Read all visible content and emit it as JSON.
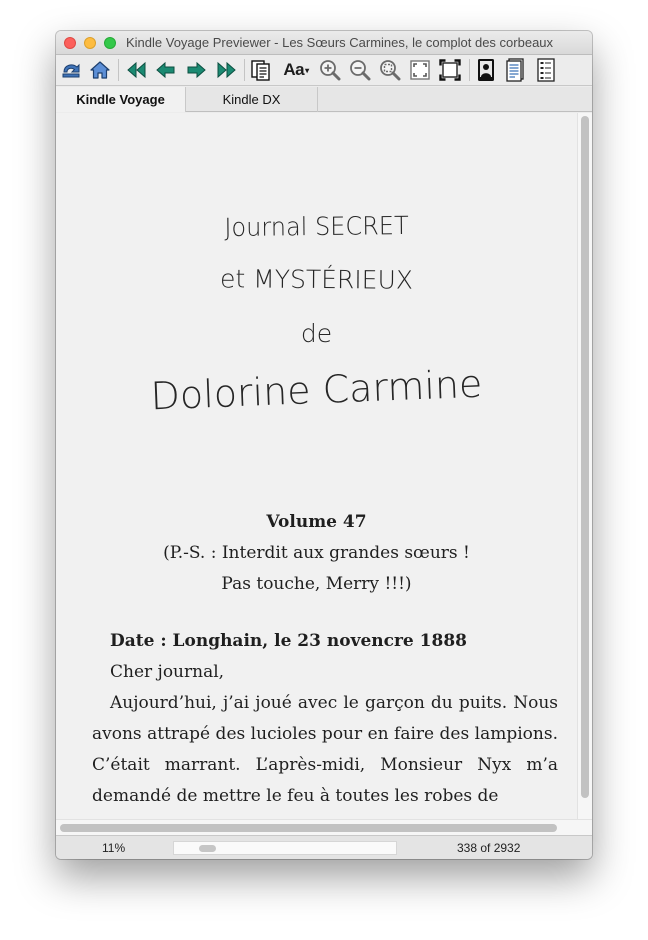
{
  "window": {
    "title": "Kindle Voyage Previewer - Les Sœurs Carmines, le complot des corbeaux"
  },
  "toolbar": {
    "font_button_label": "Aa",
    "font_button_caret": "▾"
  },
  "tabs": [
    {
      "label": "Kindle Voyage",
      "active": true
    },
    {
      "label": "Kindle DX",
      "active": false
    }
  ],
  "book": {
    "heading_lines": [
      "Journal SECRET",
      "et MYSTÉRIEUX",
      "de",
      "Dolorine Carmine"
    ],
    "volume": "Volume 47",
    "ps_line1": "(P.-S. : Interdit aux grandes sœurs !",
    "ps_line2": "Pas touche, Merry !!!)",
    "date_line": "Date : Longhain, le 23 novencre 1888",
    "salutation": "Cher journal,",
    "body": "Aujourd’hui, j’ai joué avec le garçon du puits. Nous avons attrapé des lucioles pour en faire des lampions. C’était marrant. L’après-midi, Monsieur Nyx m’a demandé de mettre le feu à toutes les robes de"
  },
  "status": {
    "percent": "11%",
    "progress_fraction": 0.11,
    "location": "338 of 2932"
  },
  "colors": {
    "icon_blue": "#3f73b8",
    "icon_teal": "#1b8a72",
    "page_background": "#f1f1f1"
  }
}
